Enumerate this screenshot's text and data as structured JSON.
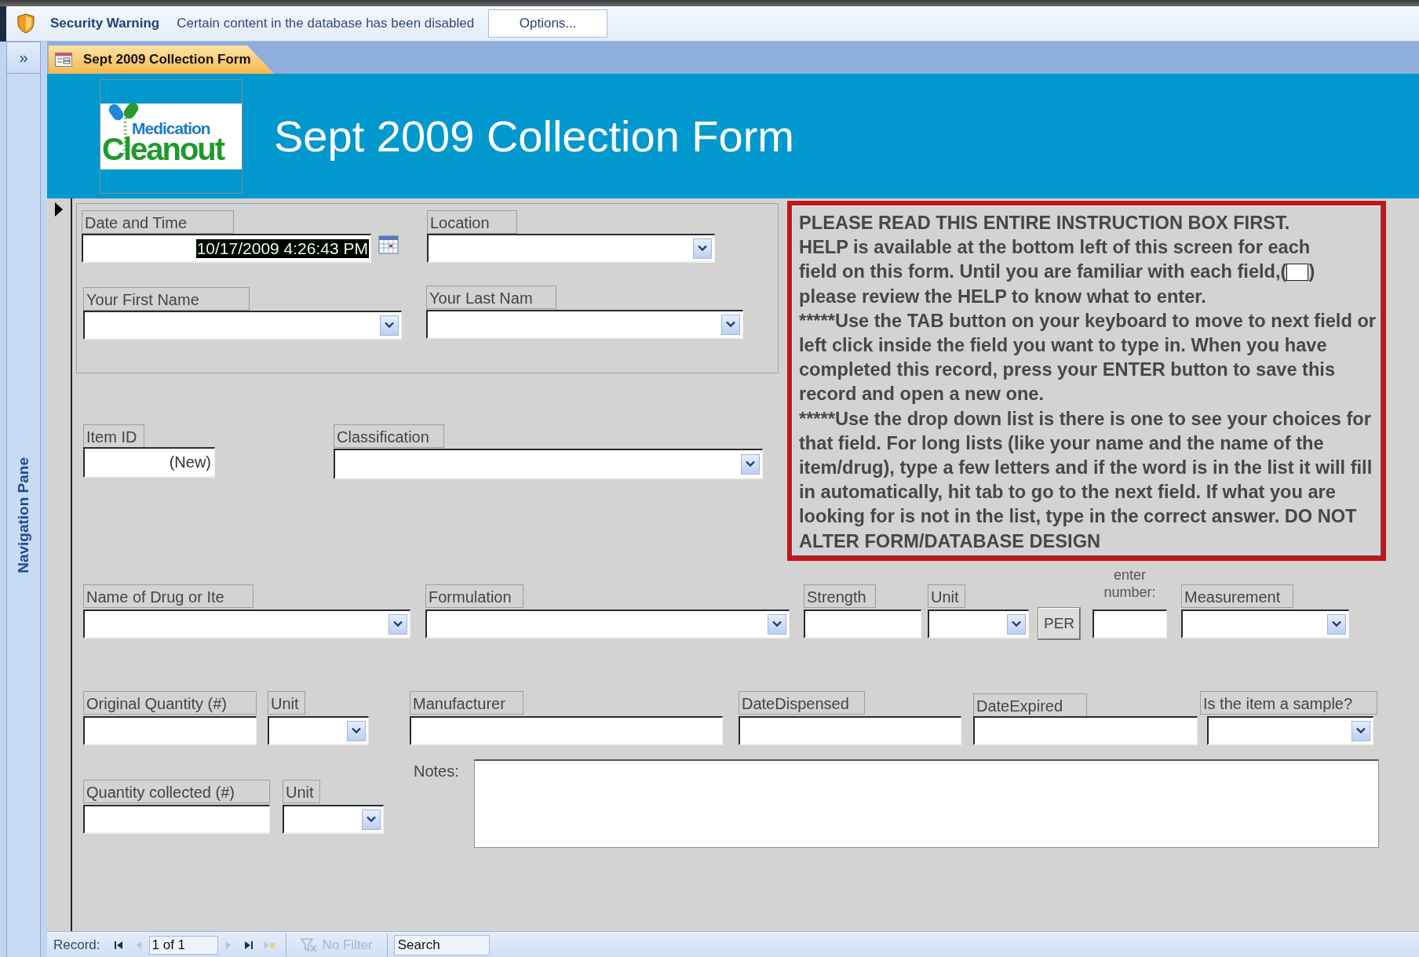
{
  "security_bar": {
    "title": "Security Warning",
    "message": "Certain content in the database has been disabled",
    "button": "Options..."
  },
  "navigation_pane": {
    "toggle": "»",
    "title": "Navigation Pane"
  },
  "tabs": [
    {
      "label": "Sept 2009 Collection Form",
      "selected": true
    }
  ],
  "header": {
    "logo": {
      "line_1": "Medication",
      "line_2": "Cleanout"
    },
    "title": "Sept 2009 Collection Form"
  },
  "fields": [
    {
      "label": "Date and Time",
      "label_boxed": true,
      "kind": "date",
      "value": "10/17/2009 4:26:43 PM",
      "focused": true
    },
    {
      "label": "Location",
      "label_boxed": true,
      "kind": "combo",
      "focused": false
    },
    {
      "label": "Your First Name",
      "label_boxed": true,
      "kind": "combo",
      "focused": false
    },
    {
      "label": "Your Last Nam",
      "label_boxed": true,
      "kind": "combo",
      "focused": false
    },
    {
      "label": "Item ID",
      "label_boxed": true,
      "kind": "text",
      "value": "(New)",
      "focused": false
    },
    {
      "label": "Classification",
      "label_boxed": true,
      "kind": "combo",
      "focused": false
    },
    {
      "label": "Name of Drug or Ite",
      "label_boxed": true,
      "kind": "combo",
      "focused": false
    },
    {
      "label": "Formulation",
      "label_boxed": true,
      "kind": "combo",
      "focused": false
    },
    {
      "label": "Strength",
      "label_boxed": true,
      "kind": "text",
      "focused": false
    },
    {
      "label": "Unit",
      "label_boxed": true,
      "kind": "combo",
      "focused": false
    },
    {
      "label": "enter number:",
      "label_boxed": false,
      "kind": "text",
      "focused": false
    },
    {
      "label": "Measurement",
      "label_boxed": true,
      "kind": "combo",
      "focused": false
    },
    {
      "label": "Original Quantity (#)",
      "label_boxed": true,
      "kind": "text",
      "focused": false
    },
    {
      "label": "Unit",
      "label_boxed": true,
      "kind": "combo",
      "focused": false
    },
    {
      "label": "Manufacturer",
      "label_boxed": true,
      "kind": "text",
      "focused": false
    },
    {
      "label": "DateDispensed",
      "label_boxed": true,
      "kind": "text",
      "focused": false
    },
    {
      "label": "DateExpired",
      "label_boxed": true,
      "kind": "text",
      "focused": false
    },
    {
      "label": "Is the item a sample?",
      "label_boxed": true,
      "kind": "combo",
      "focused": false
    },
    {
      "label": "Notes:",
      "label_boxed": false,
      "kind": "memo",
      "focused": false
    },
    {
      "label": "Quantity collected (#)",
      "label_boxed": true,
      "kind": "text",
      "focused": false
    },
    {
      "label": "Unit",
      "label_boxed": true,
      "kind": "combo",
      "focused": false
    }
  ],
  "per_button": "PER",
  "instructions": [
    {
      "text": "PLEASE READ THIS ENTIRE INSTRUCTION BOX FIRST."
    },
    {
      "text": "HELP is available at the bottom left of this screen for each"
    },
    {
      "text": "field on this form.  Until you are familiar with each field,(",
      "after": ")"
    },
    {
      "text": "please review the HELP to know what to enter."
    },
    {
      "text": "*****Use the TAB button on your keyboard to move to next field or left click inside the field you want to type in.  When you have completed this record, press your ENTER button to save this record and open a new one."
    },
    {
      "text": "*****Use the drop down list is there is one to see your choices for that field. For long lists (like your name and the name of the item/drug), type a few letters and if the word is in the list it will fill in automatically, hit tab to go to the next field. If what you are looking for is not in the list, type in the correct answer. DO NOT ALTER FORM/DATABASE DESIGN"
    }
  ],
  "status_bar": {
    "label": "Record:",
    "nav_buttons": [
      {
        "kind": "first",
        "disabled": false
      },
      {
        "kind": "previous",
        "disabled": true
      }
    ],
    "position": "1 of 1",
    "nav_buttons_after": [
      {
        "kind": "next",
        "disabled": true
      },
      {
        "kind": "last",
        "disabled": false
      },
      {
        "kind": "new",
        "disabled": true
      }
    ],
    "filter": {
      "label": "No Filter",
      "disabled": true
    },
    "search": {
      "placeholder": "Search"
    }
  }
}
